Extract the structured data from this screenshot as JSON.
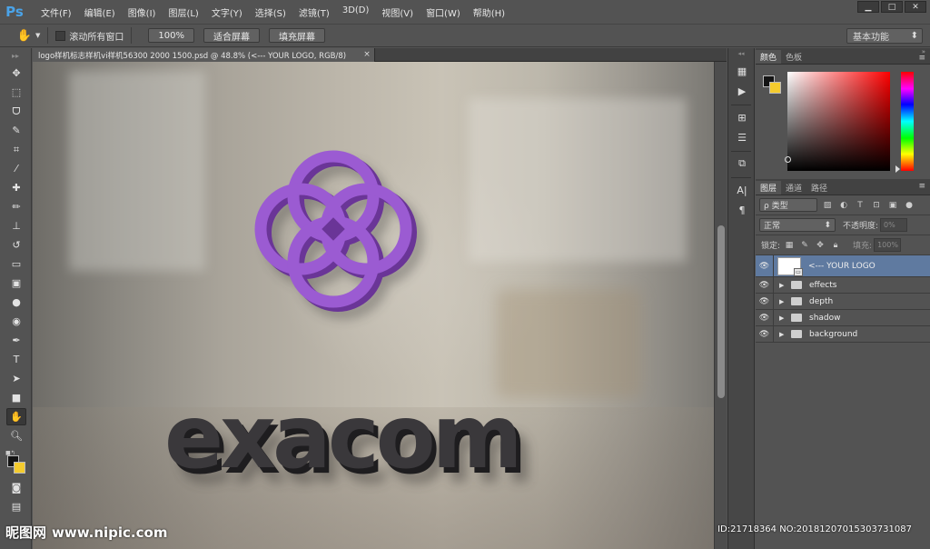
{
  "app": {
    "logo": "Ps",
    "menu": [
      "文件(F)",
      "编辑(E)",
      "图像(I)",
      "图层(L)",
      "文字(Y)",
      "选择(S)",
      "滤镜(T)",
      "3D(D)",
      "视图(V)",
      "窗口(W)",
      "帮助(H)"
    ],
    "window_controls": [
      "▁",
      "□",
      "✕"
    ]
  },
  "options": {
    "scroll_all_label": "滚动所有窗口",
    "zoom_100": "100%",
    "fit_screen": "适合屏幕",
    "fill_screen": "填充屏幕",
    "workspace": "基本功能"
  },
  "document": {
    "tab_title": "logo样机标志样机vi样机56300 2000 1500.psd @ 48.8% (<--- YOUR LOGO, RGB/8)",
    "close": "×",
    "logo_word": "exacom"
  },
  "colors": {
    "foreground": "#141414",
    "background": "#f4cb2e",
    "logo_purple": "#9a5ad0",
    "text_dark": "#2b2a2c",
    "selection": "#5f7aa0"
  },
  "color_panel": {
    "tabs": [
      "颜色",
      "色板"
    ]
  },
  "layers_panel": {
    "tabs": [
      "图层",
      "通道",
      "路径"
    ],
    "kind_label": "ρ 类型",
    "blend_mode": "正常",
    "opacity_label": "不透明度:",
    "opacity_value": "0%",
    "lock_label": "锁定:",
    "fill_label": "填充:",
    "fill_value": "100%",
    "layers": [
      {
        "name": "<--- YOUR LOGO",
        "type": "smart",
        "selected": true
      },
      {
        "name": "effects",
        "type": "group"
      },
      {
        "name": "depth",
        "type": "group"
      },
      {
        "name": "shadow",
        "type": "group"
      },
      {
        "name": "background",
        "type": "group"
      }
    ]
  },
  "watermark": {
    "site": "www.nipic.com",
    "brand": "昵图网",
    "id_text": "ID:21718364 NO:20181207015303731087"
  },
  "icons": {
    "tools": [
      "move-icon",
      "marquee-icon",
      "lasso-icon",
      "quick-select-icon",
      "crop-icon",
      "eyedropper-icon",
      "healing-icon",
      "brush-icon",
      "stamp-icon",
      "history-brush-icon",
      "eraser-icon",
      "gradient-icon",
      "blur-icon",
      "dodge-icon",
      "pen-icon",
      "type-icon",
      "path-select-icon",
      "shape-icon",
      "hand-icon",
      "zoom-icon"
    ]
  }
}
